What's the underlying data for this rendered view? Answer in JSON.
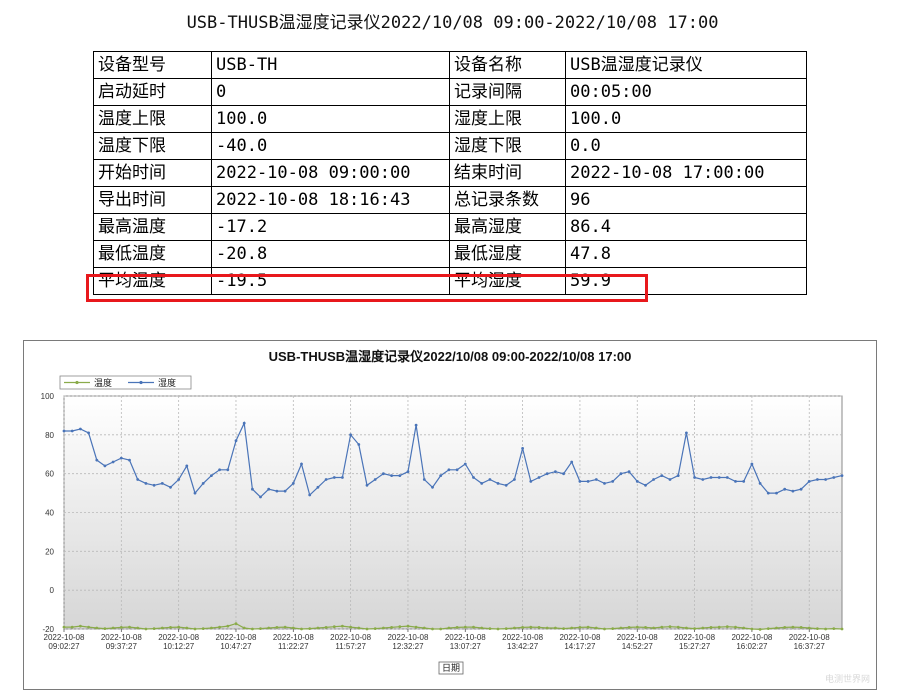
{
  "report": {
    "title": "USB-THUSB温湿度记录仪2022/10/08 09:00-2022/10/08 17:00"
  },
  "info_table": [
    [
      "设备型号",
      "USB-TH",
      "设备名称",
      "USB温湿度记录仪"
    ],
    [
      "启动延时",
      "0",
      "记录间隔",
      "00:05:00"
    ],
    [
      "温度上限",
      "100.0",
      "湿度上限",
      "100.0"
    ],
    [
      "温度下限",
      "-40.0",
      "湿度下限",
      "0.0"
    ],
    [
      "开始时间",
      "2022-10-08 09:00:00",
      "结束时间",
      "2022-10-08 17:00:00"
    ],
    [
      "导出时间",
      "2022-10-08 18:16:43",
      "总记录条数",
      "96"
    ],
    [
      "最高温度",
      "-17.2",
      "最高湿度",
      "86.4"
    ],
    [
      "最低温度",
      "-20.8",
      "最低湿度",
      "47.8"
    ],
    [
      "平均温度",
      "-19.5",
      "平均湿度",
      "59.9"
    ]
  ],
  "highlight_color": "#e8181c",
  "watermark": "电测世界网",
  "chart_data": {
    "type": "line",
    "title": "USB-THUSB温湿度记录仪2022/10/08 09:00-2022/10/08 17:00",
    "xlabel": "日期",
    "ylabel": "",
    "ylim": [
      -20,
      100
    ],
    "yticks": [
      -20,
      0,
      20,
      40,
      60,
      80,
      100
    ],
    "grid": true,
    "legend": "top-left",
    "x_start": "2022-10-08 09:02:27",
    "x_interval_minutes": 5,
    "x_tick_labels": [
      [
        "2022-10-08",
        "09:02:27"
      ],
      [
        "2022-10-08",
        "09:37:27"
      ],
      [
        "2022-10-08",
        "10:12:27"
      ],
      [
        "2022-10-08",
        "10:47:27"
      ],
      [
        "2022-10-08",
        "11:22:27"
      ],
      [
        "2022-10-08",
        "11:57:27"
      ],
      [
        "2022-10-08",
        "12:32:27"
      ],
      [
        "2022-10-08",
        "13:07:27"
      ],
      [
        "2022-10-08",
        "13:42:27"
      ],
      [
        "2022-10-08",
        "14:17:27"
      ],
      [
        "2022-10-08",
        "14:52:27"
      ],
      [
        "2022-10-08",
        "15:27:27"
      ],
      [
        "2022-10-08",
        "16:02:27"
      ],
      [
        "2022-10-08",
        "16:37:27"
      ]
    ],
    "series": [
      {
        "name": "温度",
        "color": "#8aab4a",
        "values": [
          -19.0,
          -19.0,
          -18.5,
          -19.0,
          -19.5,
          -19.8,
          -19.5,
          -19.2,
          -19.0,
          -19.5,
          -20.0,
          -19.8,
          -19.5,
          -19.2,
          -19.0,
          -19.5,
          -20.0,
          -19.8,
          -19.5,
          -19.0,
          -18.5,
          -17.2,
          -19.5,
          -20.0,
          -19.8,
          -19.5,
          -19.2,
          -19.0,
          -19.5,
          -20.0,
          -19.8,
          -19.5,
          -19.2,
          -18.8,
          -18.5,
          -19.0,
          -19.5,
          -20.0,
          -19.8,
          -19.5,
          -19.2,
          -18.8,
          -18.5,
          -19.0,
          -19.5,
          -20.0,
          -20.0,
          -19.5,
          -19.2,
          -19.0,
          -19.0,
          -19.5,
          -19.8,
          -20.0,
          -19.8,
          -19.5,
          -19.2,
          -19.0,
          -19.2,
          -19.5,
          -19.5,
          -19.8,
          -19.5,
          -19.2,
          -19.0,
          -19.5,
          -20.0,
          -19.8,
          -19.5,
          -19.2,
          -19.0,
          -19.2,
          -19.5,
          -19.0,
          -18.8,
          -19.0,
          -19.5,
          -19.8,
          -19.5,
          -19.2,
          -19.0,
          -18.8,
          -19.0,
          -19.5,
          -20.0,
          -20.2,
          -19.8,
          -19.5,
          -19.2,
          -19.0,
          -19.2,
          -19.5,
          -19.8,
          -20.0,
          -19.8,
          -20.0
        ]
      },
      {
        "name": "湿度",
        "color": "#4a74b8",
        "values": [
          82,
          82,
          83,
          81,
          67,
          64,
          66,
          68,
          67,
          57,
          55,
          54,
          55,
          53,
          57,
          64,
          50,
          55,
          59,
          62,
          62,
          77,
          86,
          52,
          48,
          52,
          51,
          51,
          55,
          65,
          49,
          53,
          57,
          58,
          58,
          80,
          75,
          54,
          57,
          60,
          59,
          59,
          61,
          85,
          57,
          53,
          59,
          62,
          62,
          65,
          58,
          55,
          57,
          55,
          54,
          57,
          73,
          56,
          58,
          60,
          61,
          60,
          66,
          56,
          56,
          57,
          55,
          56,
          60,
          61,
          56,
          54,
          57,
          59,
          57,
          59,
          81,
          58,
          57,
          58,
          58,
          58,
          56,
          56,
          65,
          55,
          50,
          50,
          52,
          51,
          52,
          56,
          57,
          57,
          58,
          59
        ]
      }
    ]
  }
}
